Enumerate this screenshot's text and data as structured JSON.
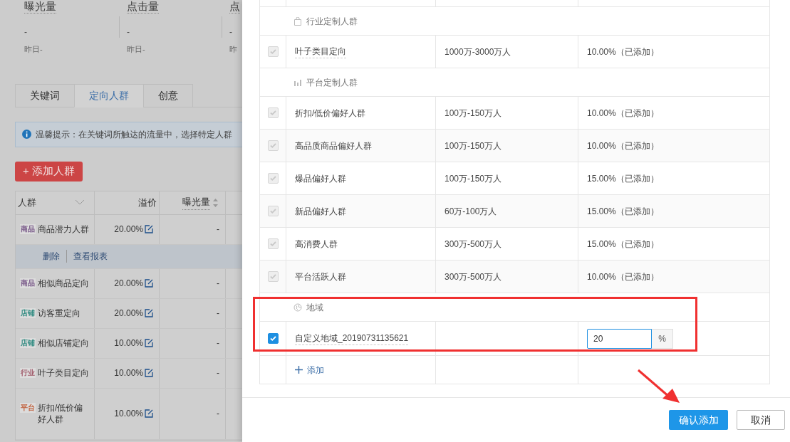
{
  "background_page": {
    "metrics": [
      {
        "label": "曝光量",
        "value": "-",
        "yesterday": "昨日-"
      },
      {
        "label": "点击量",
        "value": "-",
        "yesterday": "昨日-"
      },
      {
        "label": "点",
        "value": "-",
        "yesterday": "昨"
      }
    ],
    "tabs": [
      {
        "label": "关键词",
        "selected": false
      },
      {
        "label": "定向人群",
        "selected": true
      },
      {
        "label": "创意",
        "selected": false
      }
    ],
    "tip": "温馨提示：在关键词所触达的流量中，选择特定人群",
    "add_button": "+ 添加人群",
    "table": {
      "columns": [
        "人群",
        "溢价",
        "曝光量"
      ],
      "rows": [
        {
          "tag": "商品",
          "color": "#7a5a8a",
          "name": "商品潜力人群",
          "premium": "20.00%",
          "exposure": "-",
          "actions": [
            "删除",
            "查看报表"
          ]
        },
        {
          "tag": "商品",
          "color": "#7a5a8a",
          "name": "相似商品定向",
          "premium": "20.00%",
          "exposure": "-"
        },
        {
          "tag": "店铺",
          "color": "#2f8a80",
          "name": "访客重定向",
          "premium": "20.00%",
          "exposure": "-"
        },
        {
          "tag": "店铺",
          "color": "#2f8a80",
          "name": "相似店铺定向",
          "premium": "10.00%",
          "exposure": "-"
        },
        {
          "tag": "行业",
          "color": "#a05a6a",
          "name": "叶子类目定向",
          "premium": "10.00%",
          "exposure": "-"
        },
        {
          "tag": "平台",
          "color": "#c0603c",
          "name": "折扣/低价偏好人群",
          "premium": "10.00%",
          "exposure": "-"
        }
      ]
    }
  },
  "drawer": {
    "rows": [
      {
        "kind": "group",
        "label": "行业定制人群"
      },
      {
        "kind": "item",
        "checked": true,
        "disabled": true,
        "underlined": true,
        "name": "叶子类目定向",
        "range": "1000万-3000万人",
        "premium": "10.00%（已添加）"
      },
      {
        "kind": "group",
        "label": "平台定制人群"
      },
      {
        "kind": "item",
        "checked": true,
        "disabled": true,
        "underlined": false,
        "name": "折扣/低价偏好人群",
        "range": "100万-150万人",
        "premium": "10.00%（已添加）"
      },
      {
        "kind": "item",
        "checked": true,
        "disabled": true,
        "underlined": false,
        "name": "高品质商品偏好人群",
        "range": "100万-150万人",
        "premium": "10.00%（已添加）"
      },
      {
        "kind": "item",
        "checked": true,
        "disabled": true,
        "underlined": false,
        "name": "爆品偏好人群",
        "range": "100万-150万人",
        "premium": "15.00%（已添加）"
      },
      {
        "kind": "item",
        "checked": true,
        "disabled": true,
        "underlined": false,
        "name": "新品偏好人群",
        "range": "60万-100万人",
        "premium": "15.00%（已添加）"
      },
      {
        "kind": "item",
        "checked": true,
        "disabled": true,
        "underlined": false,
        "name": "高消费人群",
        "range": "300万-500万人",
        "premium": "15.00%（已添加）"
      },
      {
        "kind": "item",
        "checked": true,
        "disabled": true,
        "underlined": false,
        "name": "平台活跃人群",
        "range": "300万-500万人",
        "premium": "10.00%（已添加）"
      },
      {
        "kind": "group",
        "label": "地域"
      },
      {
        "kind": "custom",
        "checked": true,
        "disabled": false,
        "underlined": true,
        "name": "自定义地域_20190731135621",
        "value": "20",
        "unit": "%"
      },
      {
        "kind": "add",
        "label": "添加"
      }
    ],
    "confirm_button": "确认添加",
    "cancel_button": "取消"
  }
}
